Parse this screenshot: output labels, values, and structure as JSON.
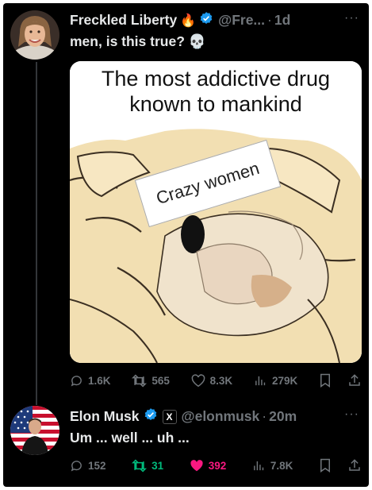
{
  "tweet1": {
    "name": "Freckled Liberty",
    "emoji_fire": "🔥",
    "handle": "@Fre...",
    "dot": "·",
    "time": "1d",
    "more": "···",
    "text": "men, is this true? ",
    "skull": "💀",
    "meme": {
      "title_line1": "The most addictive drug",
      "title_line2": "known to mankind",
      "label": "Crazy women"
    },
    "stats": {
      "replies": "1.6K",
      "retweets": "565",
      "likes": "8.3K",
      "views": "279K"
    }
  },
  "tweet2": {
    "name": "Elon Musk",
    "x_badge": "X",
    "handle": "@elonmusk",
    "dot": "·",
    "time": "20m",
    "more": "···",
    "text": "Um ... well ... uh ...",
    "stats": {
      "replies": "152",
      "retweets": "31",
      "likes": "392",
      "views": "7.8K"
    }
  },
  "colors": {
    "background": "#000000",
    "text": "#e7e9ea",
    "muted": "#71767b",
    "verified": "#1d9bf0",
    "retweet_active": "#00ba7c",
    "like_active": "#f91880"
  },
  "icons": [
    "reply-icon",
    "retweet-icon",
    "like-icon",
    "views-icon",
    "bookmark-icon",
    "share-icon",
    "verified-badge-icon",
    "more-icon"
  ]
}
